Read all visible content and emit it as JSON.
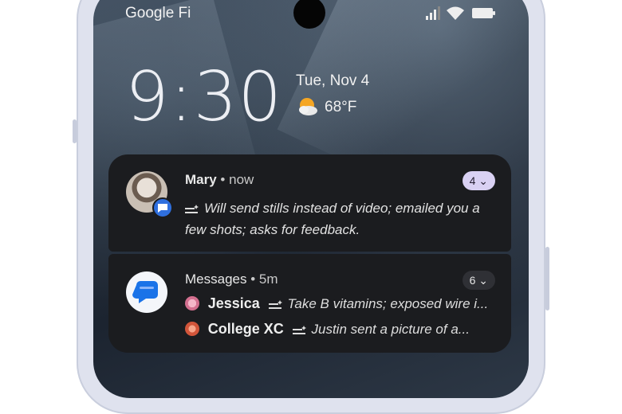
{
  "status_bar": {
    "carrier": "Google Fi"
  },
  "lockscreen": {
    "time": "9:30",
    "date": "Tue, Nov 4",
    "weather": {
      "temperature": "68°F",
      "icon": "partly-sunny-icon"
    }
  },
  "notifications": [
    {
      "sender": "Mary",
      "separator": "•",
      "time": "now",
      "count": "4",
      "summary": "Will send stills instead of video; emailed you a few shots; asks for feedback.",
      "accent": "#d9d1f3"
    },
    {
      "app": "Messages",
      "separator": "•",
      "time": "5m",
      "count": "6",
      "conversations": [
        {
          "name": "Jessica",
          "summary": "Take B vitamins; exposed wire i..."
        },
        {
          "name": "College XC",
          "summary": "Justin sent a picture of a..."
        }
      ]
    }
  ],
  "colors": {
    "card_bg": "#1b1c1f",
    "messages_blue": "#2f6fde"
  }
}
